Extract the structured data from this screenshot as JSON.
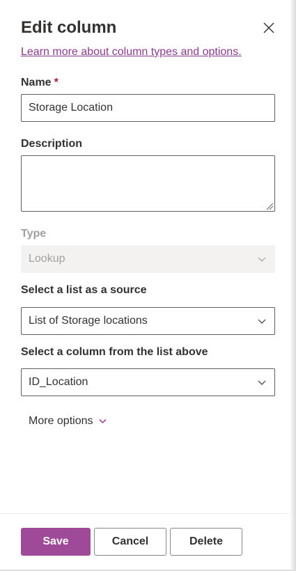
{
  "panel": {
    "title": "Edit column",
    "learn_link": "Learn more about column types and options."
  },
  "fields": {
    "name": {
      "label": "Name",
      "required_mark": "*",
      "value": "Storage Location"
    },
    "description": {
      "label": "Description",
      "value": ""
    },
    "type": {
      "label": "Type",
      "value": "Lookup",
      "disabled": true
    },
    "source_list": {
      "label": "Select a list as a source",
      "value": "List of Storage locations"
    },
    "source_column": {
      "label": "Select a column from the list above",
      "value": "ID_Location"
    }
  },
  "more_options": {
    "label": "More options",
    "icon": "chevron-down-icon"
  },
  "footer": {
    "save_label": "Save",
    "cancel_label": "Cancel",
    "delete_label": "Delete"
  },
  "icons": {
    "close": "close-icon",
    "chevron": "chevron-down-icon",
    "resize": "resize-grip-icon"
  },
  "colors": {
    "accent": "#9e4a98",
    "link": "#8a3a8e",
    "required": "#a4262c",
    "text": "#323130",
    "disabled_text": "#a19f9d",
    "disabled_bg": "#f3f2f1",
    "border": "#605e5c"
  }
}
